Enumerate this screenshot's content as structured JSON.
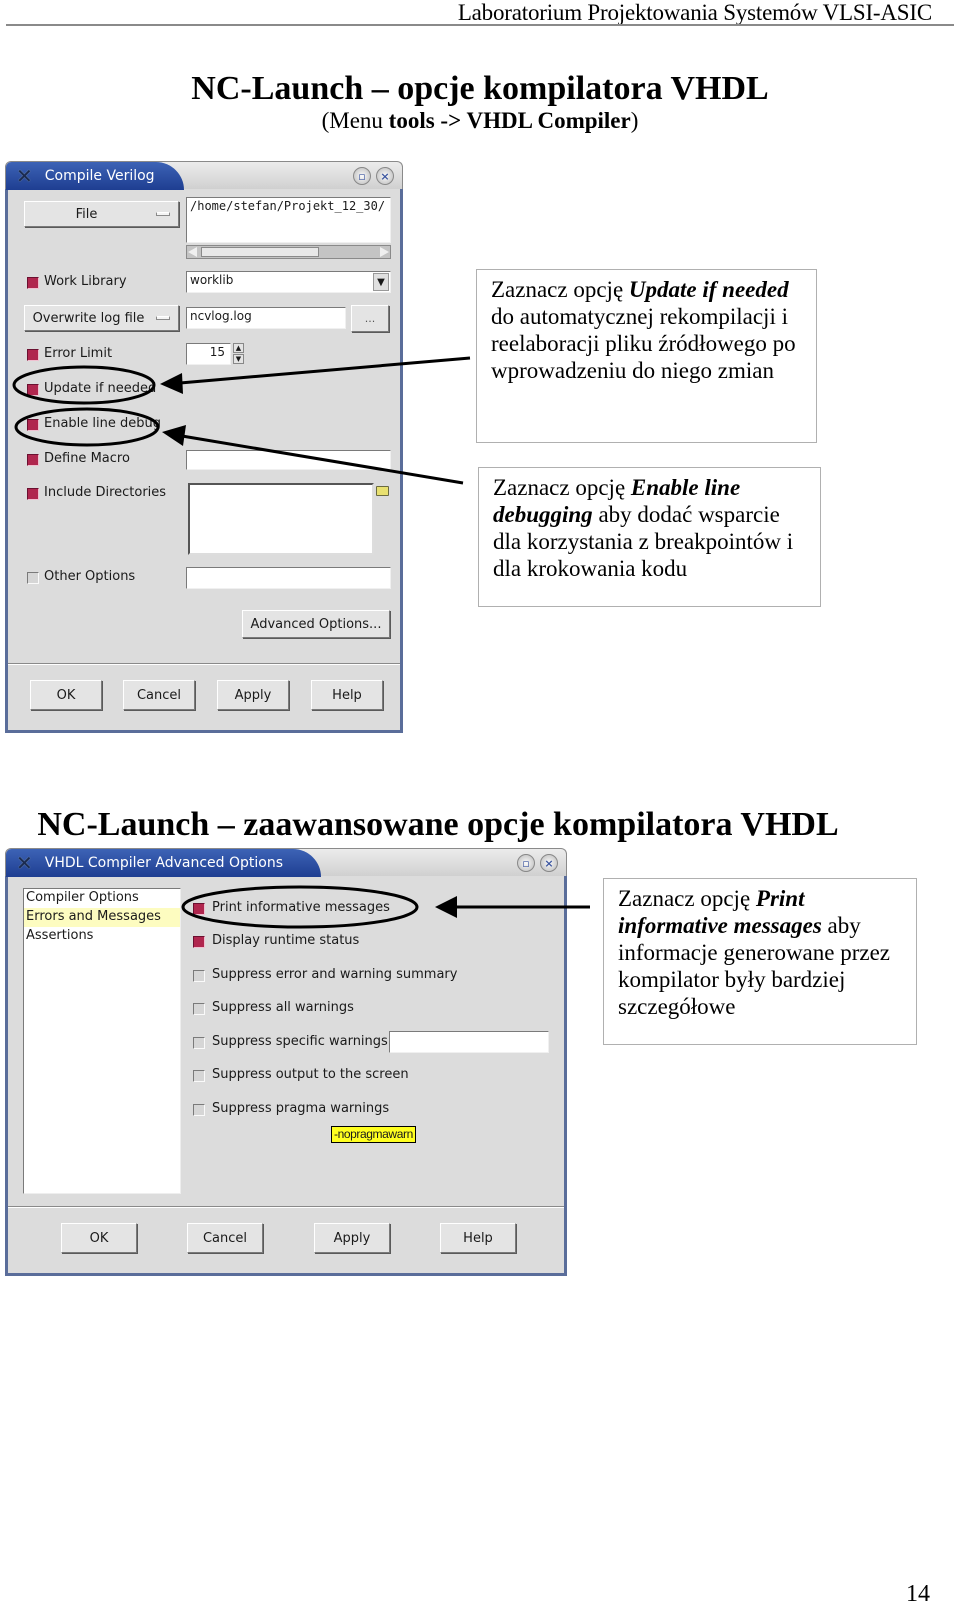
{
  "page": {
    "running_head": "Laboratorium Projektowania Systemów VLSI-ASIC",
    "title1": "NC-Launch – opcje kompilatora VHDL",
    "subtitle1": {
      "prefix": "(Menu ",
      "bold": "tools -> VHDL Compiler",
      "suffix": ")"
    },
    "title2": "NC-Launch – zaawansowane opcje kompilatora VHDL",
    "page_number": "14"
  },
  "window1": {
    "title": "Compile Verilog",
    "title_icon": "x11-logo-icon",
    "controls": [
      {
        "icon": "maximize-icon",
        "glyph": "▫"
      },
      {
        "icon": "close-icon",
        "glyph": "×"
      }
    ],
    "file_button": "File",
    "file_path": "/home/stefan/Projekt_12_30/",
    "work_library": {
      "label": "Work Library",
      "checked": true,
      "value": "worklib"
    },
    "log_mode_button": "Overwrite log file",
    "log_file": "ncvlog.log",
    "browse_button": "...",
    "error_limit": {
      "label": "Error Limit",
      "checked": true,
      "value": "15"
    },
    "update_if_needed": {
      "label": "Update if needed",
      "checked": true
    },
    "enable_line_debug": {
      "label": "Enable line debug",
      "checked": true
    },
    "define_macro": {
      "label": "Define Macro",
      "checked": true,
      "value": ""
    },
    "include_directories": {
      "label": "Include Directories",
      "checked": true,
      "value": ""
    },
    "other_options": {
      "label": "Other Options",
      "checked": false,
      "value": ""
    },
    "advanced_button": "Advanced Options...",
    "buttons": [
      "OK",
      "Cancel",
      "Apply",
      "Help"
    ],
    "accent": "#b0264e",
    "title_color": "#2a4ea3"
  },
  "callout1": {
    "prefix": "Zaznacz  opcję ",
    "bold": "Update if needed",
    "suffix": " do automatycznej rekompilacji i reelaboracji pliku źródłowego po wprowadzeniu do niego zmian"
  },
  "callout2": {
    "prefix": "Zaznacz opcję ",
    "bold": "Enable line debugging",
    "suffix": " aby dodać wsparcie dla korzystania z breakpointów i dla krokowania kodu"
  },
  "window2": {
    "title": "VHDL Compiler Advanced Options",
    "title_icon": "x11-logo-icon",
    "categories": [
      {
        "label": "Compiler Options",
        "selected": false
      },
      {
        "label": "Errors and Messages",
        "selected": true
      },
      {
        "label": "Assertions",
        "selected": false
      }
    ],
    "options": [
      {
        "label": "Print informative messages",
        "checked": true
      },
      {
        "label": "Display runtime status",
        "checked": true
      },
      {
        "label": "Suppress error and warning summary",
        "checked": false
      },
      {
        "label": "Suppress all warnings",
        "checked": false
      },
      {
        "label": "Suppress specific warnings",
        "checked": false
      },
      {
        "label": "Suppress output to the screen",
        "checked": false
      },
      {
        "label": "Suppress pragma warnings",
        "checked": false
      }
    ],
    "specific_warnings_value": "",
    "tooltip": "-nopragmawarn",
    "buttons": [
      "OK",
      "Cancel",
      "Apply",
      "Help"
    ]
  },
  "callout3": {
    "prefix": "Zaznacz opcję ",
    "bold": "Print informative messages",
    "suffix": " aby informacje generowane przez kompilator były bardziej szczegółowe"
  }
}
